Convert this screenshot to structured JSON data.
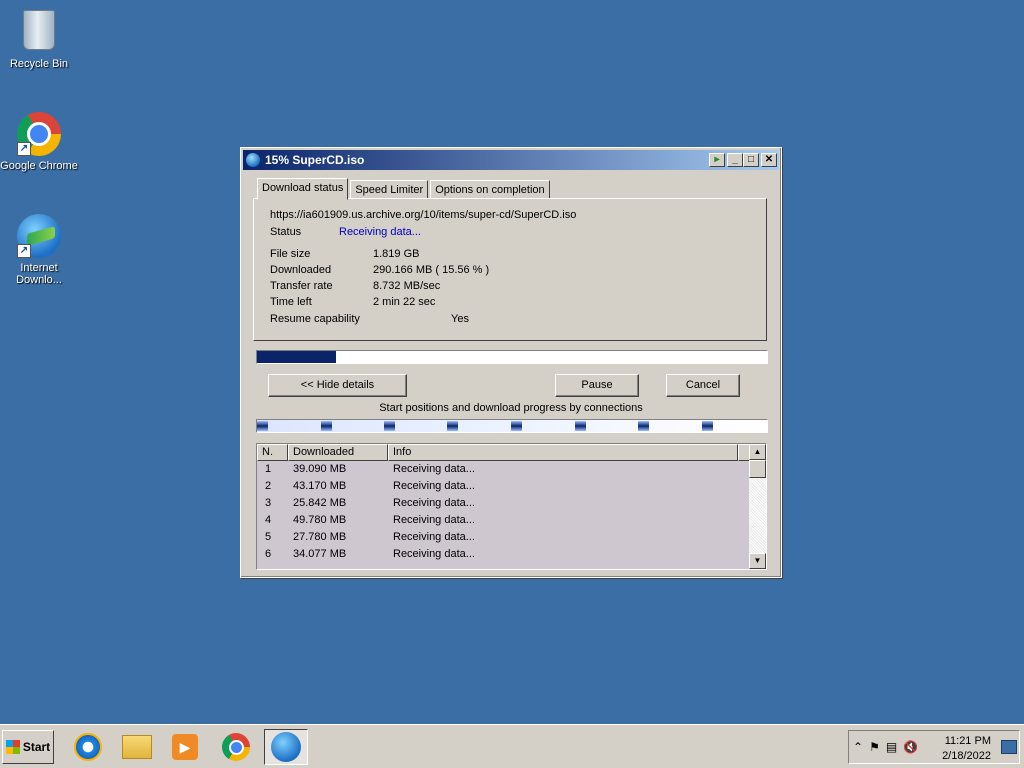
{
  "desktop": {
    "icons": [
      {
        "label": "Recycle Bin",
        "icon": "recycle-bin-icon"
      },
      {
        "label": "Google Chrome",
        "icon": "chrome-icon"
      },
      {
        "label": "Internet Downlo...",
        "icon": "idm-icon"
      }
    ]
  },
  "window": {
    "title": "15% SuperCD.iso",
    "tabs": [
      "Download status",
      "Speed Limiter",
      "Options on completion"
    ],
    "url": "https://ia601909.us.archive.org/10/items/super-cd/SuperCD.iso",
    "status_label": "Status",
    "status_value": "Receiving data...",
    "fields": [
      {
        "label": "File size",
        "value": "1.819  GB"
      },
      {
        "label": "Downloaded",
        "value": "290.166  MB  ( 15.56 % )"
      },
      {
        "label": "Transfer rate",
        "value": "8.732  MB/sec"
      },
      {
        "label": "Time left",
        "value": "2 min 22 sec"
      }
    ],
    "resume_label": "Resume capability",
    "resume_value": "Yes",
    "progress_fraction": 0.1556,
    "buttons": {
      "hide_details": "<< Hide details",
      "pause": "Pause",
      "cancel": "Cancel"
    },
    "connections_caption": "Start positions and download progress by connections",
    "table": {
      "headers": [
        "N.",
        "Downloaded",
        "Info"
      ],
      "rows": [
        [
          "1",
          "39.090  MB",
          "Receiving data..."
        ],
        [
          "2",
          "43.170  MB",
          "Receiving data..."
        ],
        [
          "3",
          "25.842  MB",
          "Receiving data..."
        ],
        [
          "4",
          "49.780  MB",
          "Receiving data..."
        ],
        [
          "5",
          "27.780  MB",
          "Receiving data..."
        ],
        [
          "6",
          "34.077  MB",
          "Receiving data..."
        ]
      ]
    }
  },
  "taskbar": {
    "start_label": "Start",
    "apps": [
      "internet-explorer-icon",
      "file-explorer-icon",
      "media-player-icon",
      "chrome-icon",
      "idm-icon"
    ],
    "time": "11:21 PM",
    "date": "2/18/2022"
  },
  "colors": {
    "desktop": "#3a6ea5",
    "titlebar_start": "#0a246a",
    "status_text": "#0000c0"
  }
}
